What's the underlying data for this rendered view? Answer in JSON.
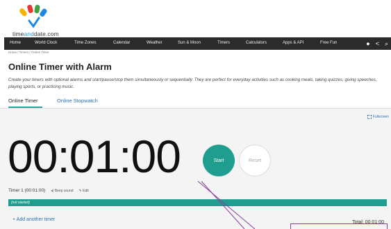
{
  "logo": {
    "part1": "time",
    "part2": "and",
    "part3": "date",
    "part4": ".com"
  },
  "nav": {
    "items": [
      "Home",
      "World Clock",
      "Time Zones",
      "Calendar",
      "Weather",
      "Sun & Moon",
      "Timers",
      "Calculators",
      "Apps & API",
      "Free Fun"
    ],
    "icons": [
      "account-icon",
      "share-icon",
      "search-icon"
    ]
  },
  "breadcrumb": "Home / Timers / Online Timer",
  "page": {
    "title": "Online Timer with Alarm",
    "intro": "Create your timers with optional alarms and start/pause/stop them simultaneously or sequentially. They are perfect for everyday activities such as cooking meals, taking quizzes, giving speeches, playing sports, or practicing music."
  },
  "tabs": {
    "active": "Online Timer",
    "other": "Online Stopwatch"
  },
  "fullscreen_label": "Fullscreen",
  "timer": {
    "display": "00:01:00",
    "start_label": "Start",
    "reset_label": "Reset",
    "name": "Timer 1 (00:01:00)",
    "sound_label": "Beep sound",
    "edit_label": "Edit",
    "status": "(not started)",
    "progress": 1.0
  },
  "add_timer_label": "+ Add another timer",
  "total_label": "Total: 00:01:00",
  "colors": {
    "accent": "#1f9e8f",
    "nav_bg": "#2b2b2b",
    "link": "#2a6fb0",
    "callout": "#8a3d9c"
  }
}
